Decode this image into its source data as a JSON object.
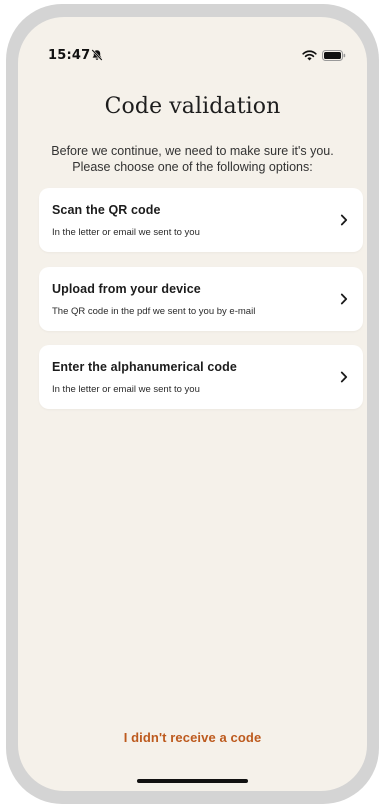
{
  "status_bar": {
    "time": "15:47",
    "icons": [
      "bell-slash-icon",
      "wifi-icon",
      "battery-icon"
    ]
  },
  "page": {
    "title": "Code validation",
    "subtitle_line1": "Before we continue, we need to make sure it's you.",
    "subtitle_line2": "Please choose one of the following options:"
  },
  "options": [
    {
      "title": "Scan the QR code",
      "description": "In the letter or email we sent to you",
      "icon": "chevron-right-icon"
    },
    {
      "title": "Upload from your device",
      "description": "The QR code in the pdf we sent to you by e-mail",
      "icon": "chevron-right-icon"
    },
    {
      "title": "Enter the alphanumerical code",
      "description": "In the letter or email we sent to you",
      "icon": "chevron-right-icon"
    }
  ],
  "footer": {
    "link_label": "I didn't receive a code"
  },
  "colors": {
    "background": "#f5f1ea",
    "card": "#ffffff",
    "accent": "#bd5a1e",
    "text": "#1e1e1e"
  }
}
